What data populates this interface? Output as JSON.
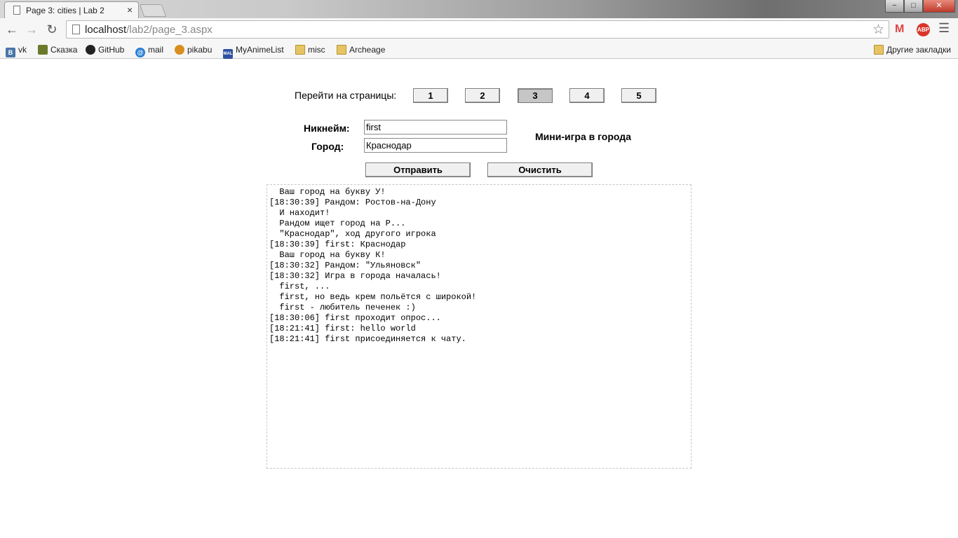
{
  "browser": {
    "tab_title": "Page 3: cities | Lab 2",
    "tab_close": "×",
    "url_host": "localhost",
    "url_path": "/lab2/page_3.aspx",
    "window_controls": {
      "minimize": "−",
      "maximize": "□",
      "close": "✕"
    },
    "bookmarks": [
      {
        "label": "vk",
        "icon": "vk-icon"
      },
      {
        "label": "Сказка",
        "icon": "skazka-icon"
      },
      {
        "label": "GitHub",
        "icon": "github-icon"
      },
      {
        "label": "mail",
        "icon": "mail-icon"
      },
      {
        "label": "pikabu",
        "icon": "pikabu-icon"
      },
      {
        "label": "MyAnimeList",
        "icon": "mal-icon"
      },
      {
        "label": "misc",
        "icon": "folder-icon"
      },
      {
        "label": "Archeage",
        "icon": "folder-icon"
      }
    ],
    "other_bookmarks": "Другие закладки"
  },
  "page": {
    "pages_label": "Перейти на страницы:",
    "page_buttons": [
      "1",
      "2",
      "3",
      "4",
      "5"
    ],
    "active_page": "3",
    "nickname_label": "Никнейм:",
    "nickname_value": "first",
    "city_label": "Город:",
    "city_value": "Краснодар",
    "game_title": "Мини-игра в города",
    "submit_label": "Отправить",
    "clear_label": "Очистить",
    "chat_lines": [
      "  Ваш город на букву У!",
      "[18:30:39] Рандом: Ростов-на-Дону",
      "  И находит!",
      "  Рандом ищет город на Р...",
      "  \"Краснодар\", ход другого игрока",
      "[18:30:39] first: Краснодар",
      "  Ваш город на букву К!",
      "[18:30:32] Рандом: \"Ульяновск\"",
      "[18:30:32] Игра в города началась!",
      "  first, ...",
      "  first, но ведь крем польётся с широкой!",
      "  first - любитель печенек :)",
      "[18:30:06] first проходит опрос...",
      "[18:21:41] first: hello world",
      "[18:21:41] first присоединяется к чату."
    ]
  }
}
